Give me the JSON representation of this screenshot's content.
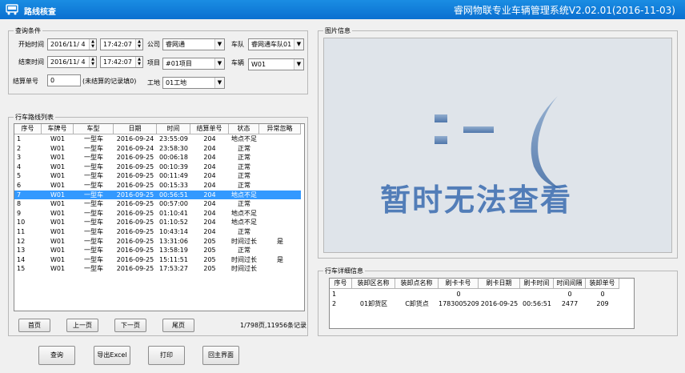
{
  "window_title": "路线核查",
  "app_title": "睿网物联专业车辆管理系统V2.02.01(2016-11-03)",
  "query": {
    "group_label": "查询条件",
    "start_time_label": "开始时间",
    "start_date": "2016/11/ 4",
    "start_time": "17:42:07",
    "end_time_label": "结束时间",
    "end_date": "2016/11/ 4",
    "end_time": "17:42:07",
    "company_label": "公司",
    "company_value": "睿网通",
    "fleet_label": "车队",
    "fleet_value": "睿网通车队01",
    "project_label": "项目",
    "project_value": "#01项目",
    "vehicle_label": "车辆",
    "vehicle_value": "W01",
    "settle_no_label": "结算单号",
    "settle_no_value": "0",
    "settle_hint": "(未结算的记录填0)",
    "site_label": "工地",
    "site_value": "01工地"
  },
  "route_list": {
    "group_label": "行车路线列表",
    "columns": [
      "序号",
      "车牌号",
      "车型",
      "日期",
      "时间",
      "结算单号",
      "状态",
      "异常忽略"
    ],
    "rows": [
      [
        "1",
        "W01",
        "一型车",
        "2016-09-24",
        "23:55:09",
        "204",
        "地点不足",
        ""
      ],
      [
        "2",
        "W01",
        "一型车",
        "2016-09-24",
        "23:58:30",
        "204",
        "正常",
        ""
      ],
      [
        "3",
        "W01",
        "一型车",
        "2016-09-25",
        "00:06:18",
        "204",
        "正常",
        ""
      ],
      [
        "4",
        "W01",
        "一型车",
        "2016-09-25",
        "00:10:39",
        "204",
        "正常",
        ""
      ],
      [
        "5",
        "W01",
        "一型车",
        "2016-09-25",
        "00:11:49",
        "204",
        "正常",
        ""
      ],
      [
        "6",
        "W01",
        "一型车",
        "2016-09-25",
        "00:15:33",
        "204",
        "正常",
        ""
      ],
      [
        "7",
        "W01",
        "一型车",
        "2016-09-25",
        "00:56:51",
        "204",
        "地点不足",
        ""
      ],
      [
        "8",
        "W01",
        "一型车",
        "2016-09-25",
        "00:57:00",
        "204",
        "正常",
        ""
      ],
      [
        "9",
        "W01",
        "一型车",
        "2016-09-25",
        "01:10:41",
        "204",
        "地点不足",
        ""
      ],
      [
        "10",
        "W01",
        "一型车",
        "2016-09-25",
        "01:10:52",
        "204",
        "地点不足",
        ""
      ],
      [
        "11",
        "W01",
        "一型车",
        "2016-09-25",
        "10:43:14",
        "204",
        "正常",
        ""
      ],
      [
        "12",
        "W01",
        "一型车",
        "2016-09-25",
        "13:31:06",
        "205",
        "时间过长",
        "是"
      ],
      [
        "13",
        "W01",
        "一型车",
        "2016-09-25",
        "13:58:19",
        "205",
        "正常",
        ""
      ],
      [
        "14",
        "W01",
        "一型车",
        "2016-09-25",
        "15:11:51",
        "205",
        "时间过长",
        "是"
      ],
      [
        "15",
        "W01",
        "一型车",
        "2016-09-25",
        "17:53:27",
        "205",
        "时间过长",
        ""
      ]
    ],
    "selected_index": 6,
    "first_page": "首页",
    "prev_page": "上一页",
    "next_page": "下一页",
    "last_page": "尾页",
    "page_info": "1/798页,11956条记录"
  },
  "picture": {
    "group_label": "图片信息",
    "sad_face": ":-(",
    "unavailable_text": "暂时无法查看"
  },
  "detail": {
    "group_label": "行车详细信息",
    "columns": [
      "序号",
      "装卸区名称",
      "装卸点名称",
      "刷卡卡号",
      "刷卡日期",
      "刷卡时间",
      "时间间隔",
      "装卸单号"
    ],
    "rows": [
      [
        "1",
        "",
        "",
        "0",
        "",
        "",
        "0",
        "0"
      ],
      [
        "2",
        "01卸货区",
        "C卸货点",
        "1783005209",
        "2016-09-25",
        "00:56:51",
        "2477",
        "209"
      ]
    ]
  },
  "actions": {
    "query": "查询",
    "export": "导出Excel",
    "print": "打印",
    "home": "回主界面"
  },
  "colors": {
    "titlebar": "#0a6fd0",
    "selection": "#3399ff"
  }
}
